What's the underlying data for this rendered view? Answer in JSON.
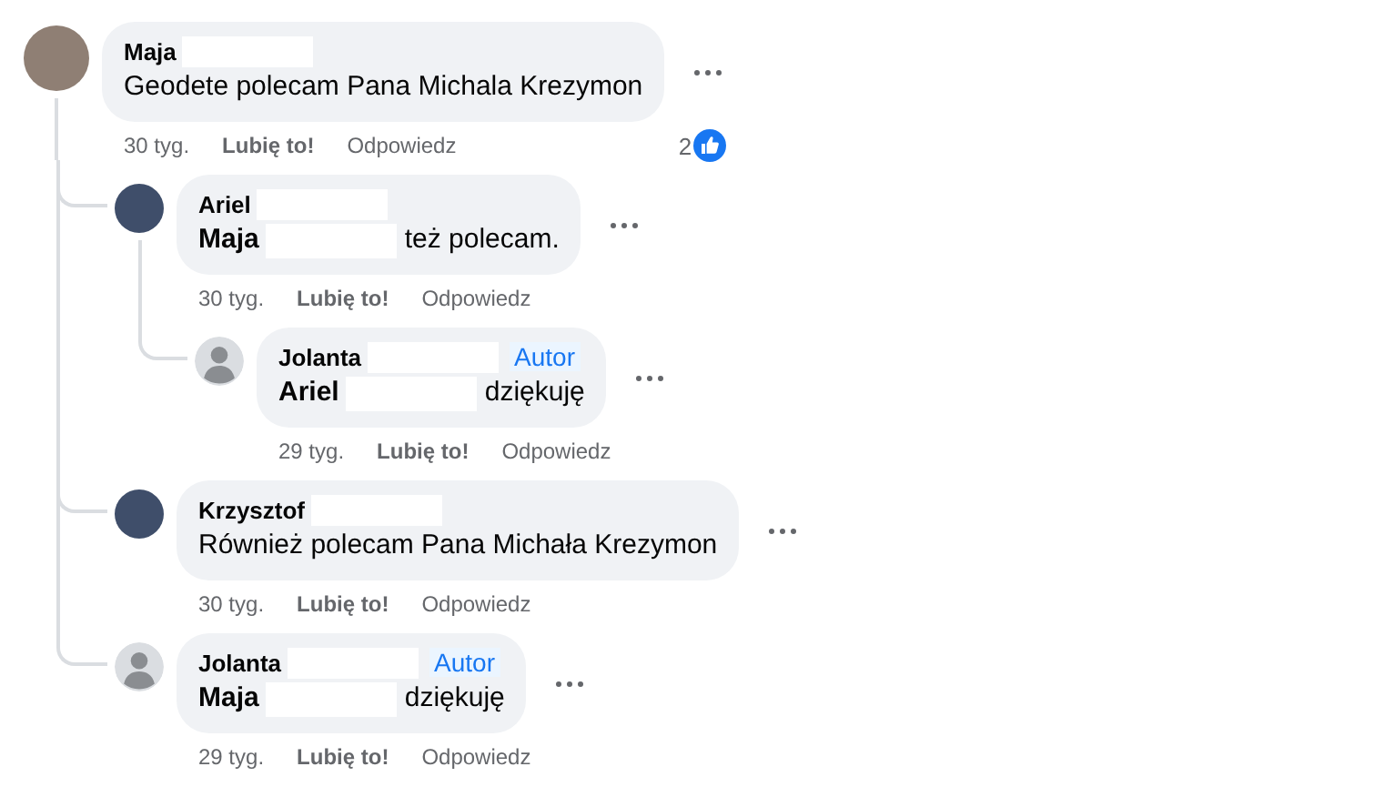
{
  "comments": [
    {
      "avatar": {
        "kind": "photo"
      },
      "author": "Maja",
      "author_redacted": true,
      "body": [
        {
          "kind": "text",
          "text": "Geodete polecam Pana Michala Krezymon"
        }
      ],
      "time": "30 tyg.",
      "like": "Lubię to!",
      "reply": "Odpowiedz",
      "reactions": "2",
      "children": [
        {
          "avatar": {
            "kind": "photo"
          },
          "author": "Ariel",
          "author_redacted": true,
          "body": [
            {
              "kind": "mention",
              "text": "Maja"
            },
            {
              "kind": "redacted"
            },
            {
              "kind": "text",
              "text": "też polecam."
            }
          ],
          "time": "30 tyg.",
          "like": "Lubię to!",
          "reply": "Odpowiedz",
          "children": [
            {
              "avatar": {
                "kind": "default"
              },
              "author": "Jolanta",
              "author_redacted": true,
              "badge": "Autor",
              "body": [
                {
                  "kind": "mention",
                  "text": "Ariel"
                },
                {
                  "kind": "redacted"
                },
                {
                  "kind": "text",
                  "text": "dziękuję"
                }
              ],
              "time": "29 tyg.",
              "like": "Lubię to!",
              "reply": "Odpowiedz"
            }
          ]
        },
        {
          "avatar": {
            "kind": "photo"
          },
          "author": "Krzysztof",
          "author_redacted": true,
          "body": [
            {
              "kind": "text",
              "text": "Również polecam Pana Michała Krezymon"
            }
          ],
          "time": "30 tyg.",
          "like": "Lubię to!",
          "reply": "Odpowiedz"
        },
        {
          "avatar": {
            "kind": "default"
          },
          "author": "Jolanta",
          "author_redacted": true,
          "badge": "Autor",
          "body": [
            {
              "kind": "mention",
              "text": "Maja"
            },
            {
              "kind": "redacted"
            },
            {
              "kind": "text",
              "text": "dziękuję"
            }
          ],
          "time": "29 tyg.",
          "like": "Lubię to!",
          "reply": "Odpowiedz"
        }
      ]
    }
  ]
}
